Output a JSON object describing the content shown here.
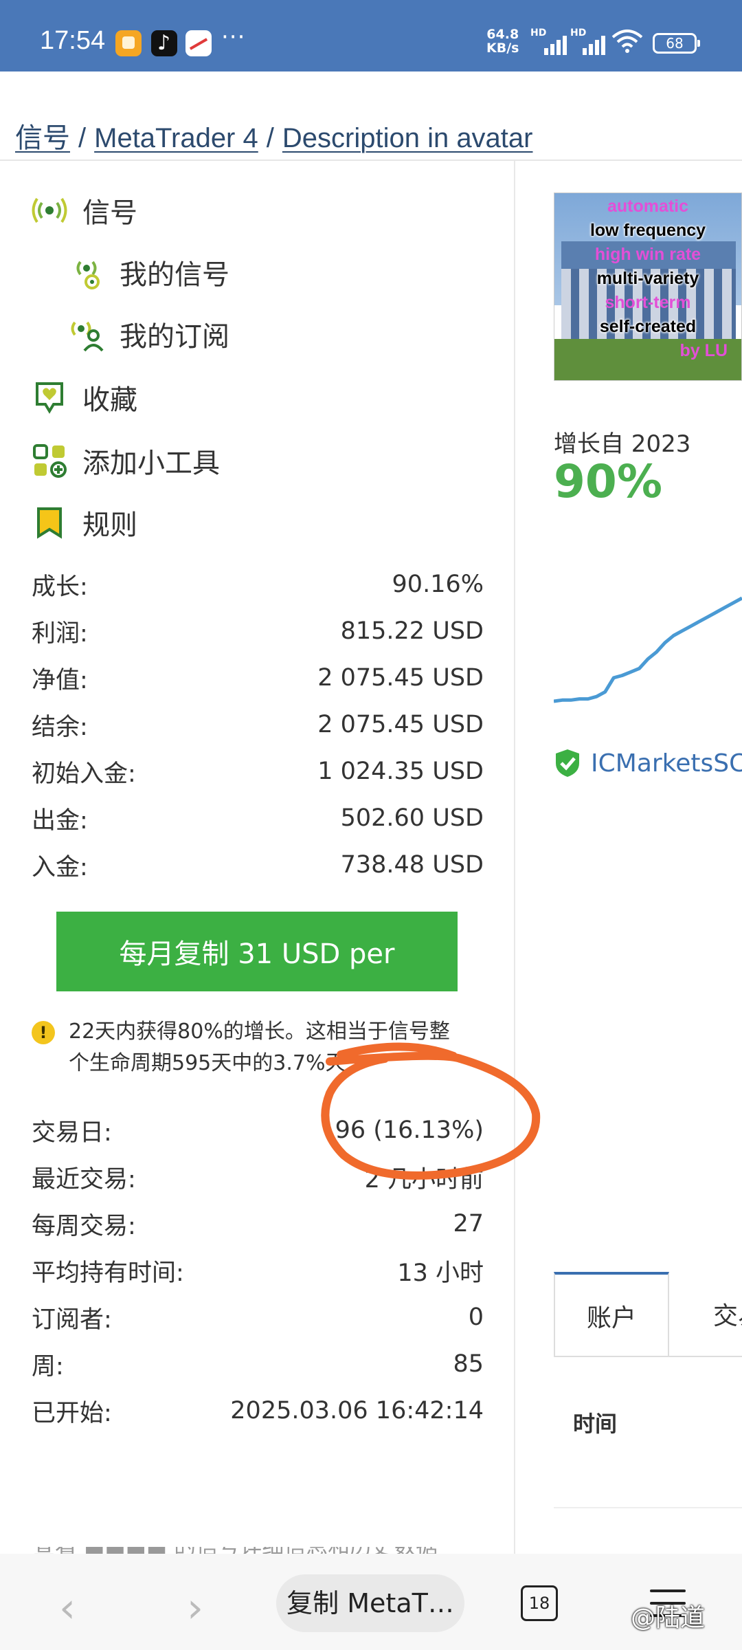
{
  "status_bar": {
    "time": "17:54",
    "speed_value": "64.8",
    "speed_unit": "KB/s",
    "hd1": "HD",
    "hd2": "HD",
    "battery": "68"
  },
  "breadcrumb": {
    "items": [
      "信号",
      "MetaTrader 4",
      "Description in avatar"
    ],
    "separator": "/"
  },
  "menu": {
    "items": [
      {
        "label": "信号",
        "icon": "signal-icon"
      },
      {
        "label": "我的信号",
        "icon": "my-signal-icon"
      },
      {
        "label": "我的订阅",
        "icon": "my-subscription-icon"
      },
      {
        "label": "收藏",
        "icon": "favorite-icon"
      },
      {
        "label": "添加小工具",
        "icon": "widget-add-icon"
      },
      {
        "label": "规则",
        "icon": "rules-bookmark-icon"
      }
    ]
  },
  "stats": [
    {
      "label": "成长:",
      "value": "90.16%"
    },
    {
      "label": "利润:",
      "value": "815.22 USD"
    },
    {
      "label": "净值:",
      "value": "2 075.45 USD"
    },
    {
      "label": "结余:",
      "value": "2 075.45 USD"
    },
    {
      "label": "初始入金:",
      "value": "1 024.35 USD"
    },
    {
      "label": "出金:",
      "value": "502.60 USD"
    },
    {
      "label": "入金:",
      "value": "738.48 USD"
    }
  ],
  "copy_button": {
    "label": "每月复制 31 USD per"
  },
  "notice": {
    "line1": "22天内获得80%的增长。这相当于信号整",
    "line2": "个生命周期595天中的3.7%天"
  },
  "stats2": [
    {
      "label": "交易日:",
      "value": "96 (16.13%)"
    },
    {
      "label": "最近交易:",
      "value": "2 几小时前"
    },
    {
      "label": "每周交易:",
      "value": "27"
    },
    {
      "label": "平均持有时间:",
      "value": "13 小时"
    },
    {
      "label": "订阅者:",
      "value": "0"
    },
    {
      "label": "周:",
      "value": "85"
    },
    {
      "label": "已开始:",
      "value": "2025.03.06 16:42:14"
    }
  ],
  "avatar": {
    "lines": [
      "automatic",
      "low frequency",
      "high win rate",
      "multi-variety",
      "short-term",
      "self-created",
      "by LU"
    ]
  },
  "growth": {
    "label": "增长自 2023",
    "value": "90%"
  },
  "chart_data": {
    "type": "line",
    "series": [
      {
        "values": [
          2,
          3,
          3,
          4,
          4,
          6,
          10,
          22,
          24,
          27,
          30,
          38,
          44,
          52,
          58,
          62,
          66,
          70,
          74,
          78,
          82,
          86,
          90
        ]
      }
    ],
    "xlabel": "",
    "ylabel": ""
  },
  "broker": {
    "label": "ICMarketsSC"
  },
  "tabs": {
    "active": "账户",
    "next": "交易"
  },
  "table": {
    "col_time": "时间"
  },
  "partial_text": "查看 ■■■■ 的信号详细信息和历史数据",
  "bottom_nav": {
    "title": "复制 MetaT…",
    "tab_count": "18",
    "watermark": "@陆道"
  },
  "colors": {
    "status_bar": "#4a78b8",
    "accent_green": "#3cb043",
    "growth_green": "#4caf50",
    "link_blue": "#2c4a6e",
    "annotation_orange": "#f06a2c"
  }
}
